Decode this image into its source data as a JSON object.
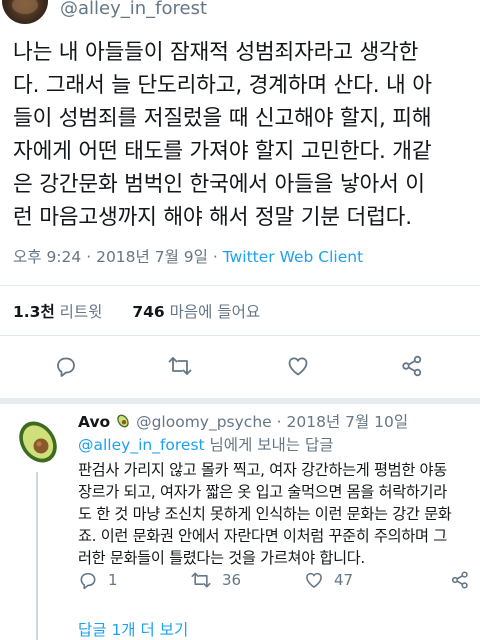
{
  "tweet": {
    "handle": "@alley_in_forest",
    "text": "나는 내 아들들이 잠재적 성범죄자라고 생각한\n다. 그래서 늘 단도리하고, 경계하며 산다. 내 아\n들이 성범죄를 저질렀을 때 신고해야 할지, 피해\n자에게 어떤 태도를 가져야 할지 고민한다. 개같\n은 강간문화 범벅인 한국에서 아들을 낳아서 이\n런 마음고생까지 해야 해서 정말 기분 더럽다.",
    "time": "오후 9:24",
    "date": "2018년 7월 9일",
    "dot": "·",
    "client": "Twitter Web Client",
    "retweet_count": "1.3천",
    "retweet_label": "리트윗",
    "like_count": "746",
    "like_label": "마음에 들어요"
  },
  "actions": {
    "icons": [
      "reply-icon",
      "retweet-icon",
      "heart-icon",
      "share-icon"
    ]
  },
  "reply": {
    "name": "Avo",
    "avatar_icon": "avocado-icon",
    "handle": "@gloomy_psyche",
    "dot": "·",
    "date": "2018년 7월 10일",
    "mention": "@alley_in_forest",
    "mention_suffix": " 님에게 보내는 답글",
    "text": "판검사 가리지 않고 몰카 찍고, 여자 강간하는게 평범한 야동\n장르가 되고, 여자가 짧은 옷 입고 술먹으면 몸을 허락하기라\n도 한 것 마냥 조신치 못하게 인식하는 이런 문화는 강간 문화\n죠. 이런 문화권 안에서 자란다면 이처럼 꾸준히 주의하며 그\n러한 문화들이 틀렸다는 것을 가르쳐야 합니다.",
    "reply_count": "1",
    "retweet_count": "36",
    "like_count": "47"
  },
  "more_replies": "답글 1개 더 보기",
  "colors": {
    "accent": "#1da1f2",
    "secondary": "#657786",
    "divider": "#e1e8ed"
  }
}
